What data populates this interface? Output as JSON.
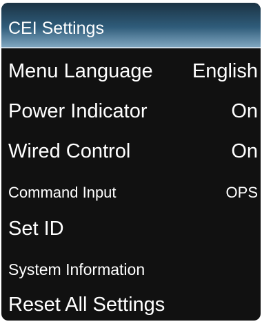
{
  "menu": {
    "title": "CEI Settings",
    "items": [
      {
        "label": "Menu Language",
        "value": "English"
      },
      {
        "label": "Power Indicator",
        "value": "On"
      },
      {
        "label": "Wired Control",
        "value": "On"
      },
      {
        "label": "Command Input",
        "value": "OPS"
      },
      {
        "label": "Set ID",
        "value": ""
      },
      {
        "label": "System Information",
        "value": ""
      },
      {
        "label": "Reset All Settings",
        "value": ""
      }
    ]
  },
  "colors": {
    "background": "#111111",
    "header_accent": "#2f5c7a",
    "text": "#ffffff"
  }
}
